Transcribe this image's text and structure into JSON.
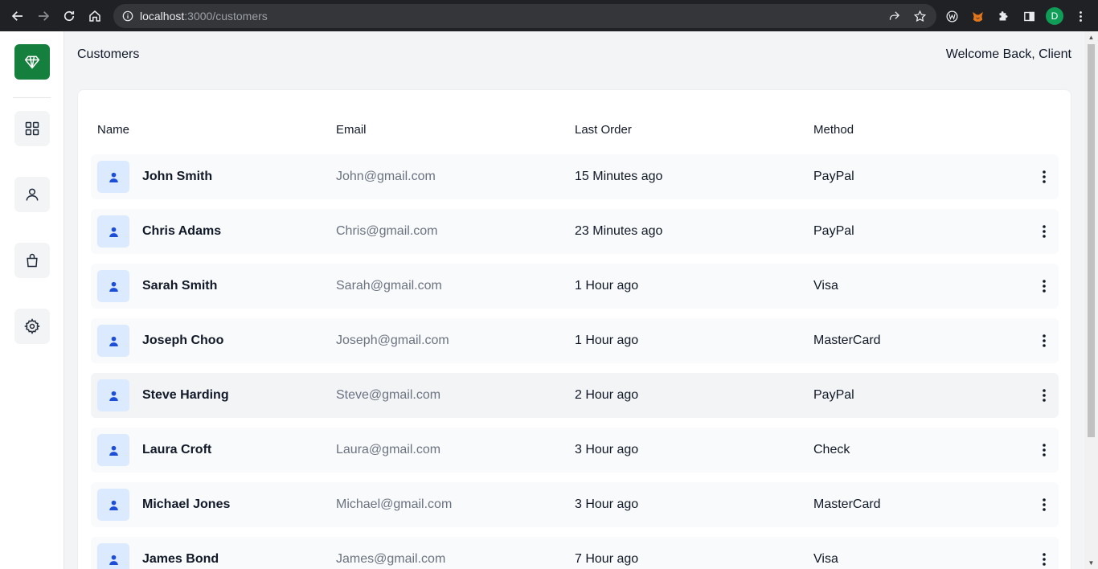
{
  "browser": {
    "url_host": "localhost",
    "url_path": ":3000/customers",
    "profile_initial": "D"
  },
  "header": {
    "title": "Customers",
    "welcome": "Welcome Back, Client"
  },
  "table": {
    "columns": [
      "Name",
      "Email",
      "Last Order",
      "Method"
    ],
    "rows": [
      {
        "name": "John Smith",
        "email": "John@gmail.com",
        "last_order": "15 Minutes ago",
        "method": "PayPal"
      },
      {
        "name": "Chris Adams",
        "email": "Chris@gmail.com",
        "last_order": "23 Minutes ago",
        "method": "PayPal"
      },
      {
        "name": "Sarah Smith",
        "email": "Sarah@gmail.com",
        "last_order": "1 Hour ago",
        "method": "Visa"
      },
      {
        "name": "Joseph Choo",
        "email": "Joseph@gmail.com",
        "last_order": "1 Hour ago",
        "method": "MasterCard"
      },
      {
        "name": "Steve Harding",
        "email": "Steve@gmail.com",
        "last_order": "2 Hour ago",
        "method": "PayPal"
      },
      {
        "name": "Laura Croft",
        "email": "Laura@gmail.com",
        "last_order": "3 Hour ago",
        "method": "Check"
      },
      {
        "name": "Michael Jones",
        "email": "Michael@gmail.com",
        "last_order": "3 Hour ago",
        "method": "MasterCard"
      },
      {
        "name": "James Bond",
        "email": "James@gmail.com",
        "last_order": "7 Hour ago",
        "method": "Visa"
      }
    ]
  },
  "colors": {
    "brand": "#15803d",
    "avatar_bg": "#dbeafe",
    "avatar_icon": "#1d4ed8"
  },
  "icons": {
    "logo": "diamond-icon",
    "sidebar": [
      "dashboard-grid-icon",
      "user-icon",
      "shopping-bag-icon",
      "settings-gear-icon"
    ]
  }
}
